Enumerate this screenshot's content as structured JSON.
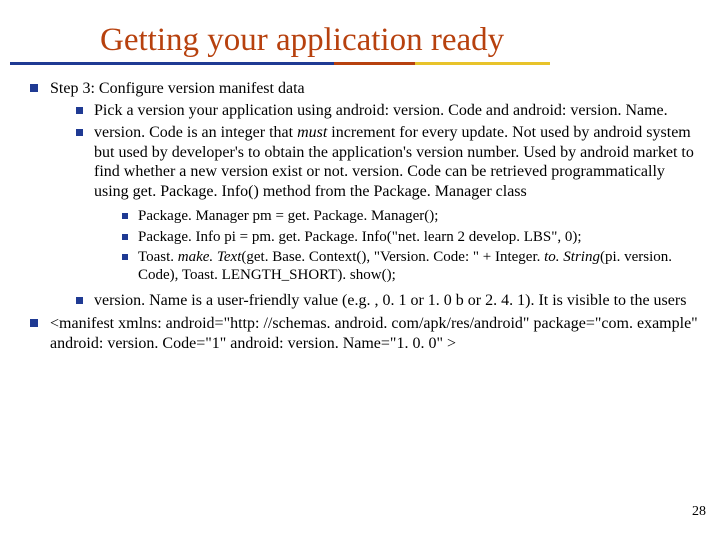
{
  "title": "Getting your application ready",
  "step_heading": "Step 3: Configure version manifest data",
  "pick_version": "Pick a version your application using  android: version. Code  and android: version. Name.",
  "version_code_desc": "version. Code  is an integer that  ",
  "version_code_must": "must",
  "version_code_desc2": "  increment for every update. Not used by android system but used by developer's to obtain the application's version number. Used by android market to find whether a new version exist or not. version. Code can be retrieved programmatically using get. Package. Info() method from the Package. Manager class",
  "code_line1": "Package. Manager pm = get. Package. Manager();",
  "code_line2": "Package. Info pi = pm. get. Package. Info(\"net. learn 2 develop. LBS\", 0);",
  "code_line3a": "Toast. ",
  "code_line3_make": "make. Text",
  "code_line3b": "(get. Base. Context(), \"Version. Code: \" + Integer. ",
  "code_line3_tostring": "to. String",
  "code_line3c": "(pi. version. Code), Toast. LENGTH_SHORT). show();",
  "version_name_desc": "version. Name  is a user-friendly value (e.g. , 0. 1 or 1. 0 b or 2. 4. 1). It is visible to the users",
  "manifest_text": "<manifest  xmlns: android=\"http: //schemas. android. com/apk/res/android\" package=\"com. example\" android: version. Code=\"1\" android: version. Name=\"1. 0. 0\" >",
  "page_number": "28"
}
